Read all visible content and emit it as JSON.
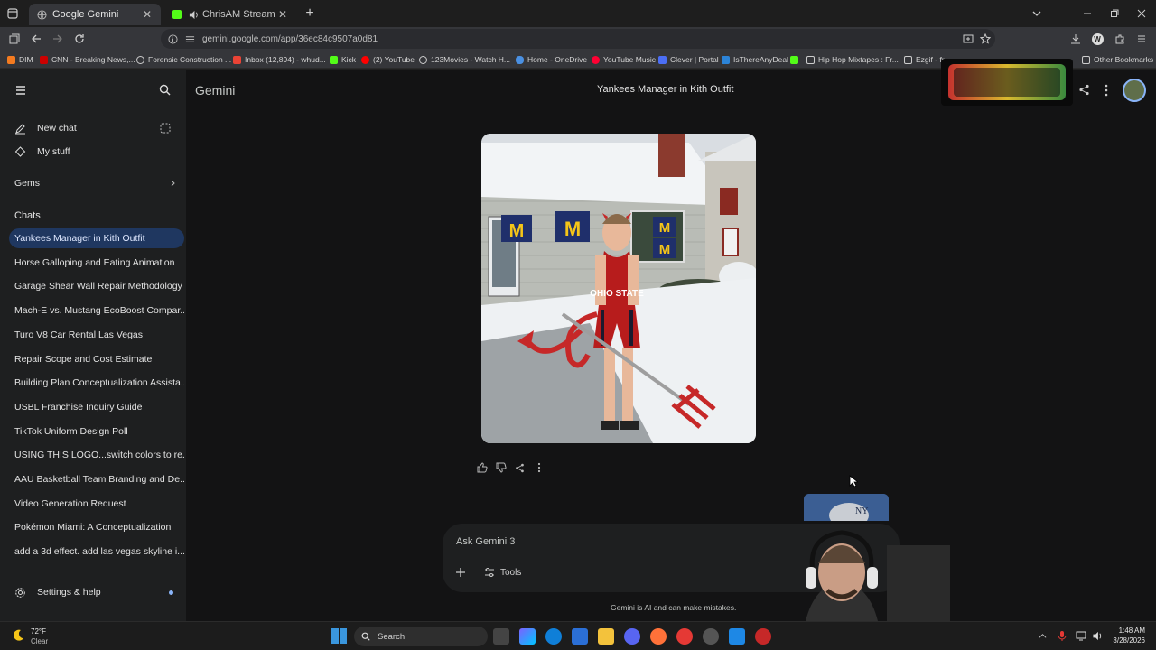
{
  "browser": {
    "tabs": [
      {
        "title": "Google Gemini",
        "active": true
      },
      {
        "title": "ChrisAM Stream - Watch Li",
        "active": false
      }
    ],
    "url": "gemini.google.com/app/36ec84c9507a0d81",
    "bookmarks": [
      "DIM",
      "CNN - Breaking News,...",
      "Forensic Construction ...",
      "Inbox (12,894) - whud...",
      "Kick",
      "(2) YouTube",
      "123Movies - Watch H...",
      "Home - OneDrive",
      "YouTube Music",
      "Clever | Portal",
      "IsThereAnyDeal",
      "Hip Hop Mixtapes : Fr...",
      "Ezgif - fr"
    ],
    "other_bookmarks": "Other Bookmarks"
  },
  "sidebar": {
    "new_chat": "New chat",
    "my_stuff": "My stuff",
    "gems": "Gems",
    "chats_heading": "Chats",
    "chats": [
      "Yankees Manager in Kith Outfit",
      "Horse Galloping and Eating Animation",
      "Garage Shear Wall Repair Methodology",
      "Mach-E vs. Mustang EcoBoost Compar...",
      "Turo V8 Car Rental Las Vegas",
      "Repair Scope and Cost Estimate",
      "Building Plan Conceptualization Assista...",
      "USBL Franchise Inquiry Guide",
      "TikTok Uniform Design Poll",
      "USING THIS LOGO...switch colors to re...",
      "AAU Basketball Team Branding and De...",
      "Video Generation Request",
      "Pokémon Miami: A Conceptualization",
      "add a 3d effect. add las vegas skyline i..."
    ],
    "settings": "Settings & help"
  },
  "main": {
    "app_name": "Gemini",
    "chat_title": "Yankees Manager in Kith Outfit",
    "image_text": {
      "shirt": "OHIO STATE"
    },
    "input_placeholder": "Ask Gemini 3",
    "tools_label": "Tools",
    "disclaimer": "Gemini is AI and can make mistakes."
  },
  "taskbar": {
    "weather_temp": "72°F",
    "weather_cond": "Clear",
    "search": "Search",
    "time": "1:48 AM",
    "date": "3/28/2026"
  },
  "colors": {
    "accent_selected": "#1f3760",
    "background": "#131314",
    "sidebar": "#1e1f20"
  }
}
